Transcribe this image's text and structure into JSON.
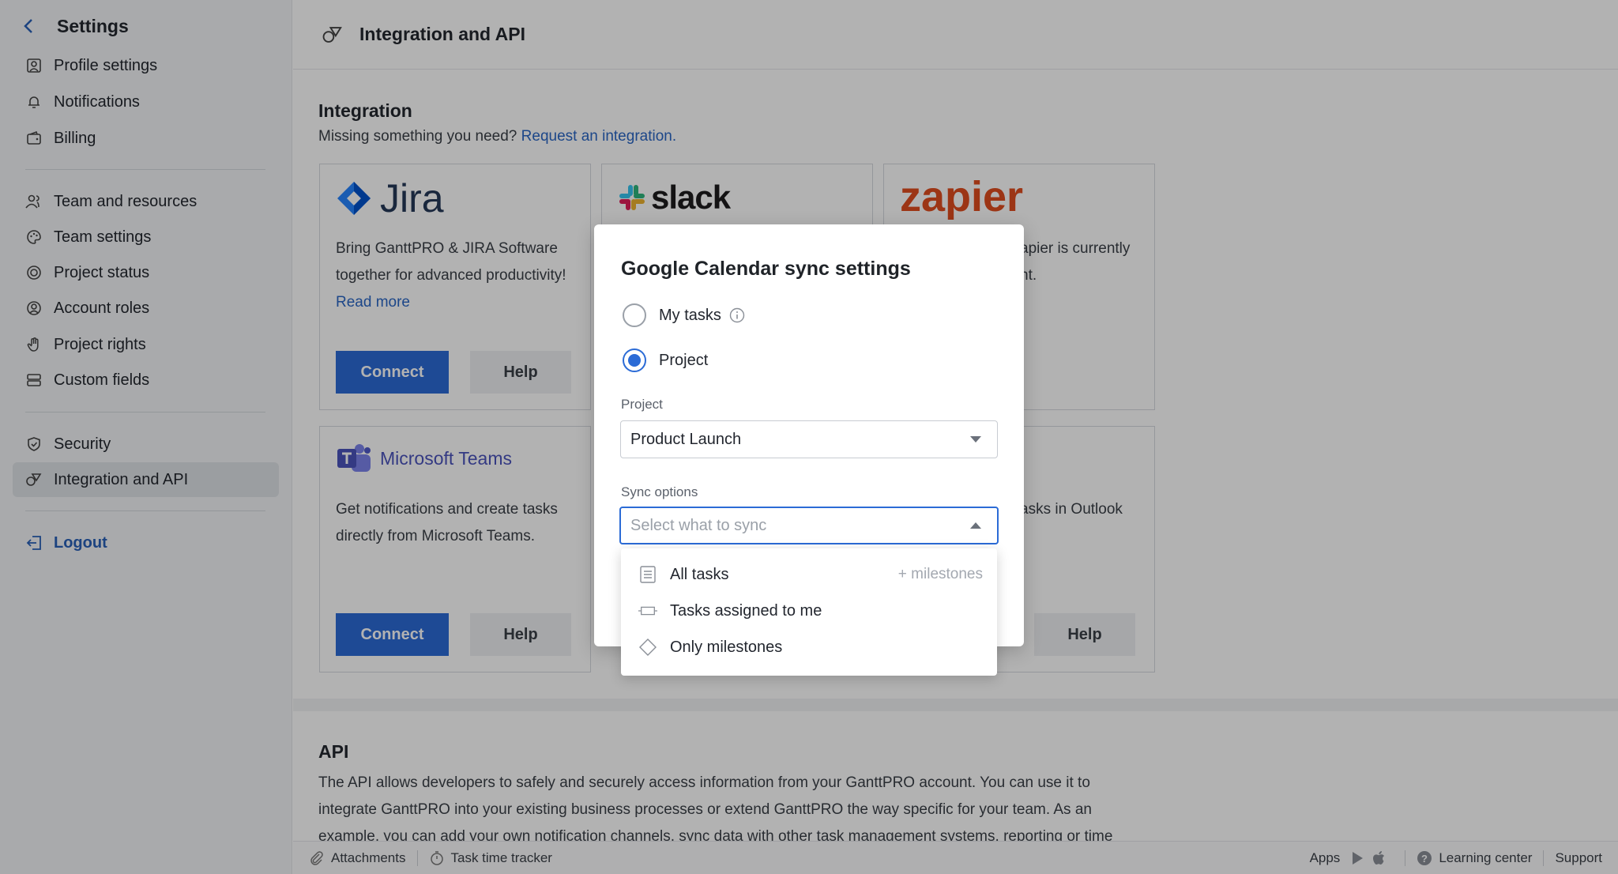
{
  "sidebar": {
    "title": "Settings",
    "items": [
      {
        "label": "Profile settings"
      },
      {
        "label": "Notifications"
      },
      {
        "label": "Billing"
      },
      {
        "label": "Team and resources"
      },
      {
        "label": "Team settings"
      },
      {
        "label": "Project status"
      },
      {
        "label": "Account roles"
      },
      {
        "label": "Project rights"
      },
      {
        "label": "Custom fields"
      },
      {
        "label": "Security"
      },
      {
        "label": "Integration and API"
      }
    ],
    "logout": "Logout"
  },
  "header": {
    "title": "Integration and API"
  },
  "integration": {
    "title": "Integration",
    "subtitle": "Missing something you need?",
    "request_link": "Request an integration.",
    "cards": {
      "jira": {
        "logo_text": "Jira",
        "desc": "Bring GanttPRO & JIRA Software together for advanced productivity!",
        "read_more": "Read more",
        "connect": "Connect",
        "help": "Help"
      },
      "slack": {
        "logo_text": "slack"
      },
      "zapier": {
        "logo_text": "zapier",
        "desc_fragment_1": "apier is currently",
        "desc_fragment_2": "nt."
      },
      "teams": {
        "logo_text": "Microsoft Teams",
        "desc": "Get notifications and create tasks directly from Microsoft Teams.",
        "connect": "Connect",
        "help": "Help"
      },
      "outlook": {
        "desc_fragment": "asks in Outlook",
        "help": "Help"
      }
    }
  },
  "api": {
    "title": "API",
    "text": "The API allows developers to safely and securely access information from your GanttPRO account. You can use it to integrate GanttPRO into your existing business processes or extend GanttPRO the way specific for your team. As an example, you can add your own notification channels, sync data with other task management systems, reporting or time"
  },
  "footer": {
    "attachments": "Attachments",
    "time_tracker": "Task time tracker",
    "apps": "Apps",
    "learning": "Learning center",
    "support": "Support"
  },
  "modal": {
    "title": "Google Calendar sync settings",
    "radio_my_tasks": "My tasks",
    "radio_project": "Project",
    "selected_radio": "Project",
    "project_label": "Project",
    "project_value": "Product Launch",
    "sync_label": "Sync options",
    "sync_placeholder": "Select what to sync"
  },
  "dropdown": {
    "options": [
      {
        "label": "All tasks",
        "hint": "+ milestones"
      },
      {
        "label": "Tasks assigned to me"
      },
      {
        "label": "Only milestones"
      }
    ]
  },
  "colors": {
    "accent": "#2b6bd6",
    "link": "#2a66c4",
    "zapier": "#e04d1f",
    "teams": "#4b53bc"
  }
}
